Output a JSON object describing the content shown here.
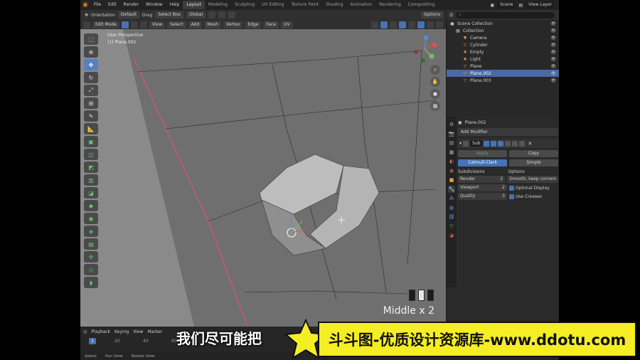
{
  "menubar": {
    "items": [
      "File",
      "Edit",
      "Render",
      "Window",
      "Help"
    ],
    "workspaces": [
      "Layout",
      "Modeling",
      "Sculpting",
      "UV Editing",
      "Texture Paint",
      "Shading",
      "Animation",
      "Rendering",
      "Compositing"
    ],
    "active_workspace": "Layout",
    "scene": "Scene",
    "view_layer": "View Layer"
  },
  "viewport_header": {
    "orientation": "Orientation",
    "orientation_value": "Default",
    "drag": "Drag",
    "select_box": "Select Box",
    "transform": "Global",
    "options": "Options",
    "mode": "Edit Mode",
    "menus": [
      "View",
      "Select",
      "Add",
      "Mesh",
      "Vertex",
      "Edge",
      "Face",
      "UV"
    ]
  },
  "viewport": {
    "info_line1": "User Perspective",
    "info_line2": "(1) Plane.002",
    "keycast": "Middle x 2"
  },
  "outliner": {
    "search_placeholder": "",
    "rows": [
      {
        "label": "Scene Collection",
        "icon": "scene-collection-icon",
        "selected": false
      },
      {
        "label": "Collection",
        "icon": "collection-icon",
        "selected": false
      },
      {
        "label": "Camera",
        "icon": "camera-icon",
        "selected": false
      },
      {
        "label": "Cylinder",
        "icon": "mesh-icon",
        "selected": false
      },
      {
        "label": "Empty",
        "icon": "empty-icon",
        "selected": false
      },
      {
        "label": "Light",
        "icon": "light-icon",
        "selected": false
      },
      {
        "label": "Plane",
        "icon": "mesh-icon",
        "selected": false
      },
      {
        "label": "Plane.002",
        "icon": "mesh-icon",
        "selected": true
      },
      {
        "label": "Plane.003",
        "icon": "mesh-icon",
        "selected": false
      }
    ]
  },
  "properties": {
    "object_name": "Plane.002",
    "add_modifier": "Add Modifier",
    "modifier_name": "Sub",
    "apply": "Apply",
    "copy": "Copy",
    "catmull_clark": "Catmull-Clark",
    "simple": "Simple",
    "subdivisions_label": "Subdivisions",
    "options_label": "Options",
    "render_label": "Render",
    "render_value": "2",
    "viewport_label": "Viewport",
    "viewport_value": "2",
    "quality_label": "Quality",
    "quality_value": "3",
    "uv_smooth": "Smooth, keep corners",
    "optimal_display": "Optimal Display",
    "use_creases": "Use Creases"
  },
  "timeline": {
    "playback": "Playback",
    "keying": "Keying",
    "view": "View",
    "marker": "Marker",
    "current_frame": "1",
    "ruler": [
      "20",
      "40",
      "60"
    ]
  },
  "statusbar": {
    "items": [
      "Select",
      "Pan View",
      "Rotate View"
    ]
  },
  "overlay": {
    "subtitle": "我们尽可能把",
    "watermark": "斗斗图-优质设计资源库-www.ddotu.com",
    "brand_color": "#f5ee25"
  }
}
